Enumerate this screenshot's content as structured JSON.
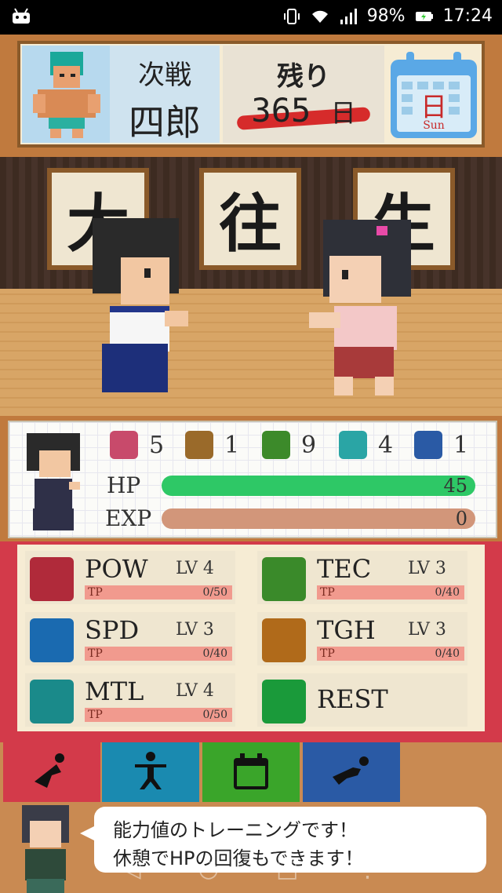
{
  "status_bar": {
    "battery": "98%",
    "time": "17:24",
    "icons": [
      "android-icon",
      "vibrate-icon",
      "wifi-icon",
      "signal-icon",
      "battery-icon"
    ]
  },
  "header": {
    "next_label": "次戦",
    "opponent_name": "四郎",
    "remaining_label": "残り",
    "days_value": "365",
    "days_unit": "日",
    "calendar_kanji": "日",
    "calendar_day": "Sun"
  },
  "arena": {
    "scrolls": [
      "大",
      "往",
      "生"
    ]
  },
  "stats": {
    "chips": [
      {
        "icon": "power-fist-icon",
        "value": "5",
        "color": "#c84a6b"
      },
      {
        "icon": "shield-icon",
        "value": "1",
        "color": "#9a6a2a"
      },
      {
        "icon": "green-dice-icon",
        "value": "9",
        "color": "#3c8a2a"
      },
      {
        "icon": "teal-dice-icon",
        "value": "4",
        "color": "#2aa5a5"
      },
      {
        "icon": "blue-dice-icon",
        "value": "1",
        "color": "#2a5aa5"
      }
    ],
    "hp_label": "HP",
    "hp_value": "45",
    "hp_fill": 1.0,
    "exp_label": "EXP",
    "exp_value": "0",
    "exp_fill": 0.0
  },
  "training": [
    {
      "name": "POW",
      "lv": "LV 4",
      "tp_label": "TP",
      "tp": "0/50",
      "icon": "muscle-arm-icon",
      "color": "#b02a3a"
    },
    {
      "name": "TEC",
      "lv": "LV 3",
      "tp_label": "TP",
      "tp": "0/40",
      "icon": "kungfu-pose-icon",
      "color": "#3a8a2a"
    },
    {
      "name": "SPD",
      "lv": "LV 3",
      "tp_label": "TP",
      "tp": "0/40",
      "icon": "running-icon",
      "color": "#1a6ab0"
    },
    {
      "name": "TGH",
      "lv": "LV 3",
      "tp_label": "TP",
      "tp": "0/40",
      "icon": "flex-body-icon",
      "color": "#b06a1a"
    },
    {
      "name": "MTL",
      "lv": "LV 4",
      "tp_label": "TP",
      "tp": "0/50",
      "icon": "brain-head-icon",
      "color": "#1a8a8a"
    },
    {
      "name": "REST",
      "icon": "bed-icon",
      "color": "#1a9a3a"
    }
  ],
  "tabs": [
    {
      "name": "training-tab",
      "icon": "kick-icon",
      "color": "#d33a4a"
    },
    {
      "name": "technique-tab",
      "icon": "martial-arts-icon",
      "color": "#1a8ab0"
    },
    {
      "name": "schedule-tab",
      "icon": "calendar-icon",
      "color": "#3aa52a"
    },
    {
      "name": "special-tab",
      "icon": "flying-kick-icon",
      "color": "#2a5aa5"
    }
  ],
  "message": {
    "line1": "能力値のトレーニングです！",
    "line2": "休憩でHPの回復もできます！"
  }
}
